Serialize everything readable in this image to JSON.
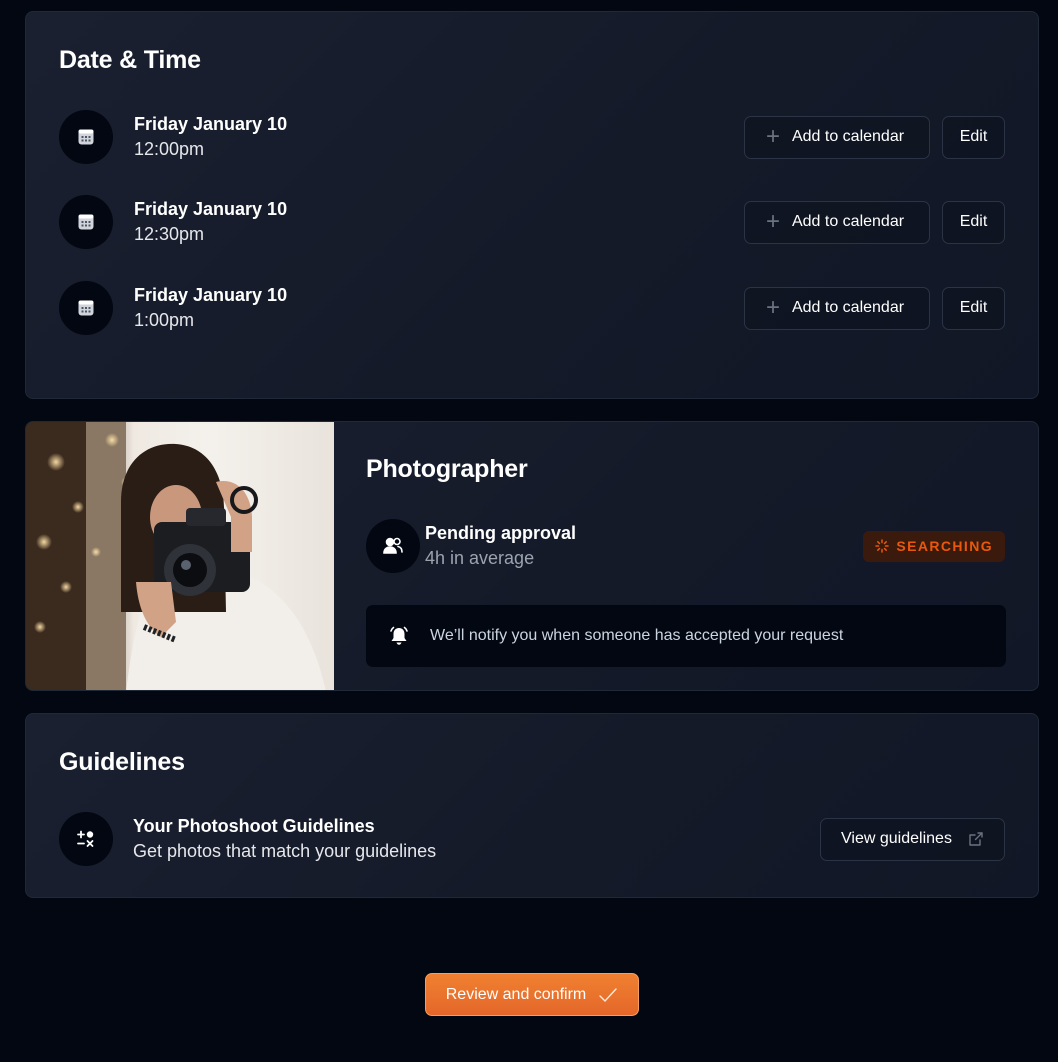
{
  "date_time": {
    "title": "Date & Time",
    "slots": [
      {
        "day": "Friday January 10",
        "time": "12:00pm"
      },
      {
        "day": "Friday January 10",
        "time": "12:30pm"
      },
      {
        "day": "Friday January 10",
        "time": "1:00pm"
      }
    ],
    "add_label": "Add to calendar",
    "edit_label": "Edit"
  },
  "photographer": {
    "title": "Photographer",
    "status_title": "Pending approval",
    "status_sub": "4h in average",
    "badge": "SEARCHING",
    "notice": "We’ll notify you when someone has accepted your request"
  },
  "guidelines": {
    "title": "Guidelines",
    "item_title": "Your Photoshoot Guidelines",
    "item_sub": "Get photos that match your guidelines",
    "view_label": "View guidelines"
  },
  "confirm_label": "Review and confirm",
  "colors": {
    "accent": "#ea580c",
    "badge_bg": "#3b1a0e",
    "page_bg": "#030712",
    "card_border": "#1f2937"
  },
  "icons": [
    "calendar-icon",
    "users-icon",
    "bell-icon",
    "shapes-icon",
    "external-link-icon",
    "plus-icon",
    "spinner-icon",
    "check-icon"
  ]
}
